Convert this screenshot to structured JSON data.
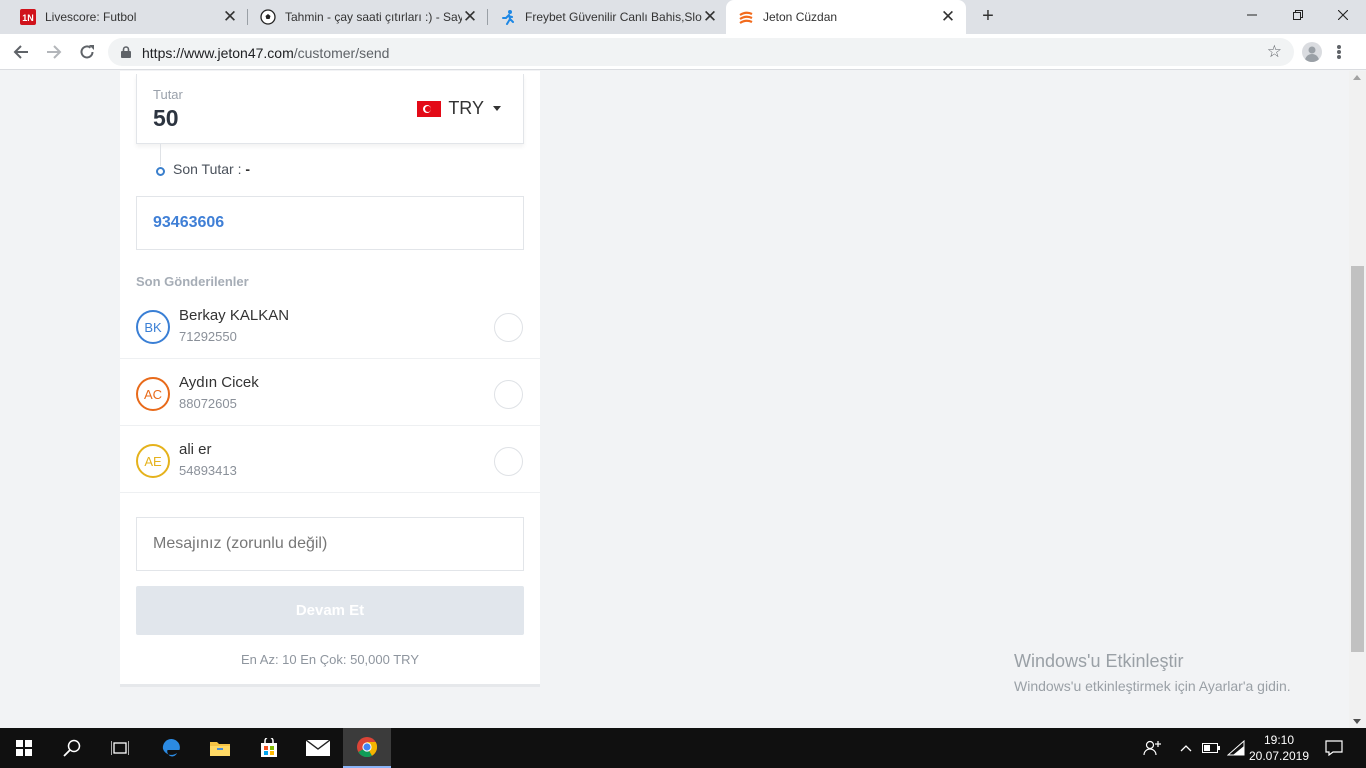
{
  "browser": {
    "tabs": [
      {
        "title": "Livescore: Futbol",
        "icon": "livescore-icon",
        "active": false
      },
      {
        "title": "Tahmin - çay saati çıtırları :) - Say",
        "icon": "soccer-ball-icon",
        "active": false
      },
      {
        "title": "Freybet Güvenilir Canlı Bahis,Slot",
        "icon": "runner-icon",
        "active": false
      },
      {
        "title": "Jeton Cüzdan",
        "icon": "jeton-icon",
        "active": true
      }
    ],
    "new_tab": "+",
    "url_host": "https://www.jeton47.com",
    "url_path": "/customer/send",
    "star": "☆",
    "close_glyph": "✕"
  },
  "form": {
    "amount_label": "Tutar",
    "amount_value": "50",
    "currency": "TRY",
    "final_amount_label": "Son Tutar : ",
    "final_amount_value": "-",
    "account_number": "93463606",
    "recent_title": "Son Gönderilenler",
    "recent": [
      {
        "initials": "BK",
        "name": "Berkay KALKAN",
        "number": "71292550",
        "color": "#3a7fd5"
      },
      {
        "initials": "AC",
        "name": "Aydın Cicek",
        "number": "88072605",
        "color": "#e86a1a"
      },
      {
        "initials": "AE",
        "name": "ali er",
        "number": "54893413",
        "color": "#e5b21c"
      }
    ],
    "message_placeholder": "Mesajınız (zorunlu değil)",
    "continue_label": "Devam Et",
    "limits": "En Az: 10 En Çok: 50,000 TRY"
  },
  "watermark": {
    "title": "Windows'u Etkinleştir",
    "text": "Windows'u etkinleştirmek için Ayarlar'a gidin."
  },
  "taskbar": {
    "time": "19:10",
    "date": "20.07.2019"
  }
}
